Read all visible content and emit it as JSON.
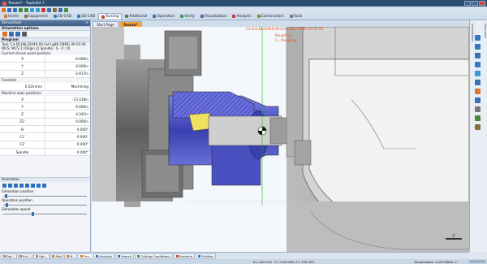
{
  "titlebar": {
    "title": "Tessen* - TopSolid 7"
  },
  "ribbon": {
    "tabs": [
      {
        "label": "Home",
        "icon": "home-icon",
        "color": "#d9742a"
      },
      {
        "label": "Equipment",
        "icon": "equipment-icon",
        "color": "#8a6e3b"
      },
      {
        "label": "2D-CAD",
        "icon": "sketch-icon",
        "color": "#2f7ac0"
      },
      {
        "label": "3D-CAD",
        "icon": "shape-icon",
        "color": "#2f7ac0"
      },
      {
        "label": "Turning",
        "icon": "turning-icon",
        "color": "#c84a2a",
        "active": true
      },
      {
        "label": "Additional",
        "icon": "additional-icon",
        "color": "#4a8a3a"
      },
      {
        "label": "Operation",
        "icon": "operation-icon",
        "color": "#3a6fb3"
      },
      {
        "label": "Verify",
        "icon": "verify-icon",
        "color": "#3a9a5a"
      },
      {
        "label": "Visualization",
        "icon": "visualization-icon",
        "color": "#6a5aa8"
      },
      {
        "label": "Analysis",
        "icon": "analysis-icon",
        "color": "#c83a3a"
      },
      {
        "label": "Construction",
        "icon": "construction-icon",
        "color": "#8a8a3a"
      },
      {
        "label": "Tools",
        "icon": "tools-icon",
        "color": "#777777"
      }
    ]
  },
  "panel": {
    "title": "Simulation",
    "options_title": "Simulation options",
    "program_title": "Program",
    "tool_line": "Tool: C3-DCLNL22040-09 Ext Lg80 CNMG 09 03 04",
    "wcs_line": "WCS: WCS 1 [Origin 2] Spindle : S - 0 ; 0]",
    "current_pos_title": "Current driven point position",
    "current_pos": [
      {
        "axis": "X",
        "value": "0.000in"
      },
      {
        "axis": "Y",
        "value": "0.000in"
      },
      {
        "axis": "Z",
        "value": "-3.917in"
      }
    ],
    "feedrate_title": "Feedrate",
    "feedrate_value": "0.02in/rev",
    "feedrate_mode": "Machining",
    "axes_title": "Machine axes positions",
    "axes": [
      {
        "axis": "X",
        "value": "-13.318in"
      },
      {
        "axis": "Y",
        "value": "0.000in"
      },
      {
        "axis": "Z",
        "value": "4.341in"
      },
      {
        "axis": "Z2'",
        "value": "0.000in"
      },
      {
        "axis": "B",
        "value": "0.000°"
      },
      {
        "axis": "C1'",
        "value": "0.000°"
      },
      {
        "axis": "C2'",
        "value": "0.000°"
      },
      {
        "axis": "Spindle",
        "value": "0.000°"
      }
    ],
    "animation_title": "Animation",
    "sim_position_label": "Simulation position",
    "op_position_label": "Operation position",
    "sim_speed_label": "Simulation speed",
    "sim_position": 0.02,
    "op_position": 0.03,
    "sim_speed": 0.35,
    "bottom_tabs": [
      "Opt...",
      "Ent...",
      "Opt...",
      "Pals",
      "M...",
      "Sim..."
    ]
  },
  "doc_tabs": {
    "start_page": "Start Page",
    "active": "Tessen*"
  },
  "viewport": {
    "tool_label": "C3-DCLNL22040-09 Ext Lg80 CNMG 09 03 04",
    "op_label": "Roughing",
    "op_label2": "1 - Roughing",
    "scale_value": "1\""
  },
  "right_bar": {
    "label_left": "Visualization",
    "label_right": "Geometry",
    "icons": [
      "pan-icon",
      "zoom-icon",
      "rotate-icon",
      "view-icon",
      "fit-icon",
      "section-icon",
      "render-icon",
      "camera-icon",
      "grid-icon",
      "settings-icon",
      "layers-icon"
    ]
  },
  "bottom_tabs": [
    {
      "label": "Analysis",
      "icon": "analysis-icon",
      "color": "#3a6fb3"
    },
    {
      "label": "Search",
      "icon": "search-icon",
      "color": "#3a6fb3"
    },
    {
      "label": "Cutting Conditions",
      "icon": "cutting-conditions-icon",
      "color": "#4a8a3a"
    },
    {
      "label": "Scenario",
      "icon": "scenario-icon",
      "color": "#c84a2a"
    },
    {
      "label": "Entities",
      "icon": "entities-icon",
      "color": "#2f7ac0"
    }
  ],
  "status": {
    "x": "X=-203.143",
    "y": "Y=+100.000",
    "z": "Z=-355.355",
    "visualization": "Visualization: 0.007486m 1\""
  },
  "colors": {
    "title_bar": "#2d4e73",
    "active_doc_tab": "#f7a33a",
    "part_blue": "#5a5fd0",
    "chuck_gray": "#7a7a7a",
    "highlight": "#e0521c"
  }
}
